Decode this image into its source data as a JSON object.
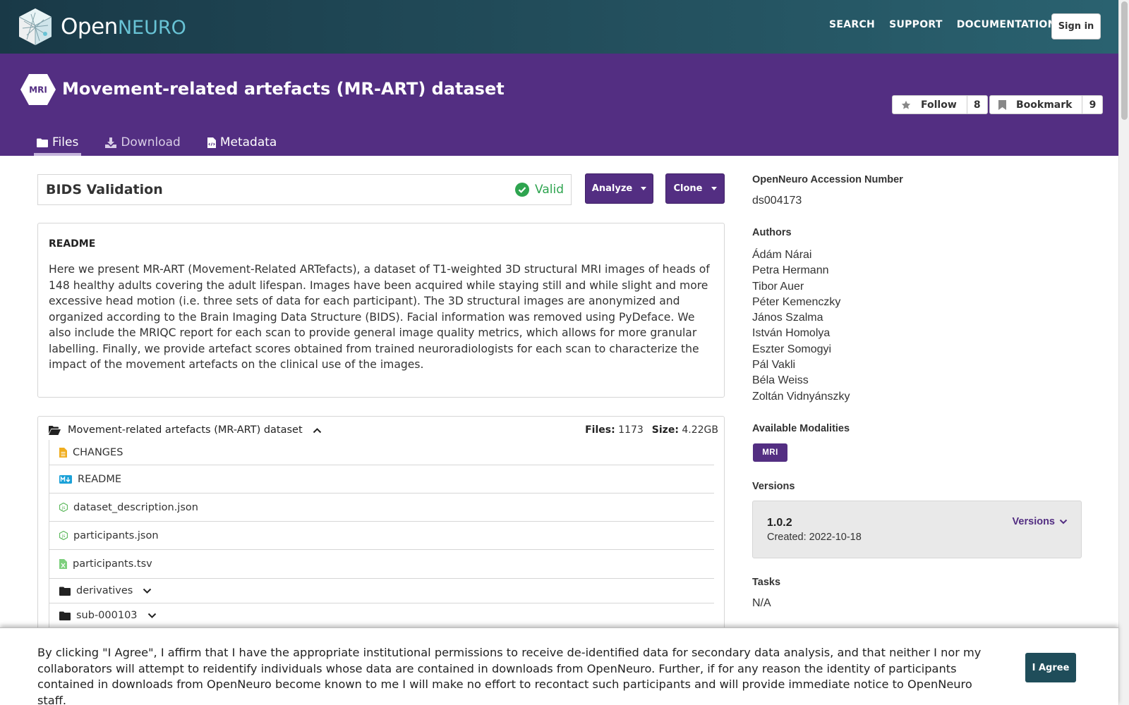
{
  "brand": {
    "open": "Open",
    "neuro": "NEURO"
  },
  "nav": {
    "links": [
      "SEARCH",
      "SUPPORT",
      "DOCUMENTATION"
    ],
    "signin": "Sign in"
  },
  "dataset": {
    "modality_badge": "MRI",
    "title": "Movement-related artefacts (MR-ART) dataset",
    "follow": {
      "label": "Follow",
      "count": "8"
    },
    "bookmark": {
      "label": "Bookmark",
      "count": "9"
    }
  },
  "tabs": [
    {
      "label": "Files",
      "icon": "folder-icon",
      "active": true
    },
    {
      "label": "Download",
      "icon": "download-icon",
      "active": false
    },
    {
      "label": "Metadata",
      "icon": "file-code-icon",
      "active": false
    }
  ],
  "validation": {
    "title": "BIDS Validation",
    "status": "Valid"
  },
  "actions": {
    "analyze": "Analyze",
    "clone": "Clone"
  },
  "readme": {
    "heading": "README",
    "body": "Here we present MR-ART (Movement-Related ARTefacts), a dataset of T1-weighted 3D structural MRI images of heads of 148 healthy adults covering the adult lifespan. Images have been acquired while staying still and while slight and more excessive head motion (i.e. three sets of data for each participant). The 3D structural images are anonymized and organized according to the Brain Imaging Data Structure (BIDS). Facial information was removed using PyDeface. We also include the MRIQC report for each scan to provide general image quality metrics, which allows for more granular labelling. Finally, we provide artefact scores obtained from trained neuroradiologists for each scan to characterize the impact of the movement artefacts on the clinical use of the images."
  },
  "files": {
    "root": "Movement-related artefacts (MR-ART) dataset",
    "files_label": "Files:",
    "files_count": "1173",
    "size_label": "Size:",
    "size_value": "4.22GB",
    "items": [
      {
        "name": "CHANGES",
        "icon": "file-text-icon",
        "color": "#f0ad1f"
      },
      {
        "name": "README",
        "icon": "markdown-icon",
        "color": "#1ba1d8"
      },
      {
        "name": "dataset_description.json",
        "icon": "json-file-icon",
        "color": "#5cb85c"
      },
      {
        "name": "participants.json",
        "icon": "json-file-icon",
        "color": "#5cb85c"
      },
      {
        "name": "participants.tsv",
        "icon": "tsv-file-icon",
        "color": "#5cb85c"
      },
      {
        "name": "derivatives",
        "icon": "folder-icon",
        "folder": true
      },
      {
        "name": "sub-000103",
        "icon": "folder-icon",
        "folder": true
      }
    ]
  },
  "sidebar": {
    "accession_label": "OpenNeuro Accession Number",
    "accession": "ds004173",
    "authors_label": "Authors",
    "authors": [
      "Ádám Nárai",
      "Petra Hermann",
      "Tibor Auer",
      "Péter Kemenczky",
      "János Szalma",
      "István Homolya",
      "Eszter Somogyi",
      "Pál Vakli",
      "Béla Weiss",
      "Zoltán Vidnyánszky"
    ],
    "modalities_label": "Available Modalities",
    "modalities": [
      "MRI"
    ],
    "versions_label": "Versions",
    "version": "1.0.2",
    "created": "Created: 2022-10-18",
    "versions_link": "Versions",
    "tasks_label": "Tasks",
    "tasks": "N/A"
  },
  "consent": {
    "text": "By clicking \"I Agree\", I affirm that I have the appropriate institutional permissions to receive de-identified data for secondary data analysis, and that neither I nor my collaborators will attempt to reidentify individuals whose data are contained in downloads from OpenNeuro. Further, if for any reason the identity of participants contained in downloads from OpenNeuro become known to me I will make no effort to recontact such participants and will provide immediate notice to OpenNeuro staff.",
    "agree": "I Agree"
  },
  "colors": {
    "brand_purple": "#532e82",
    "nav_teal": "#234f5d",
    "valid_green": "#2ea44f",
    "agree_teal": "#1f4d5a"
  }
}
